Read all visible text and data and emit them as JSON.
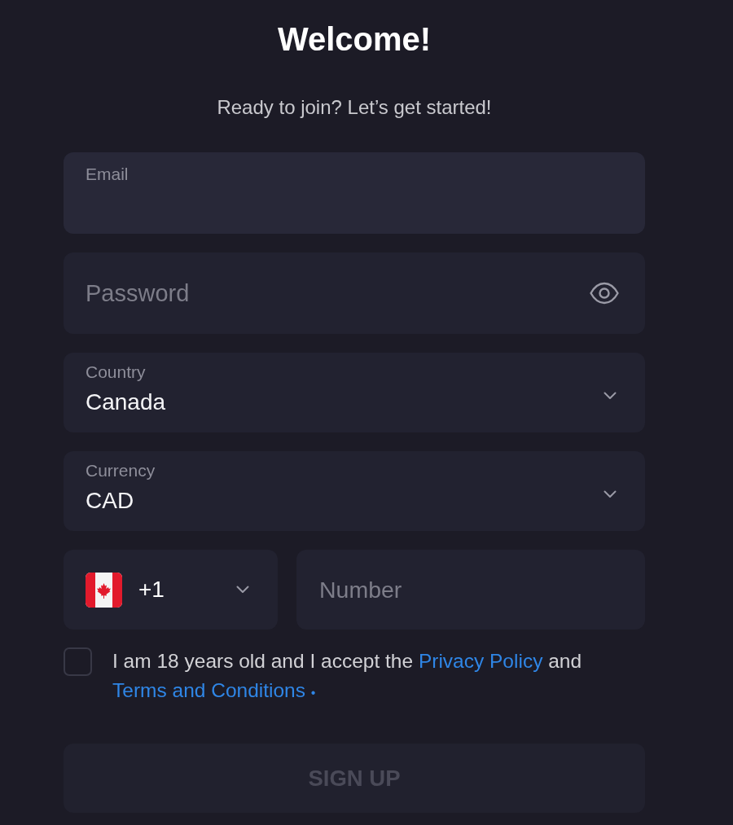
{
  "header": {
    "title": "Welcome!",
    "subtitle": "Ready to join? Let’s get started!"
  },
  "fields": [
    {
      "kind": "email",
      "label": "Email",
      "focused": true
    },
    {
      "kind": "password",
      "placeholder": "Password"
    },
    {
      "kind": "select",
      "label": "Country",
      "value": "Canada"
    },
    {
      "kind": "select",
      "label": "Currency",
      "value": "CAD"
    }
  ],
  "phone": {
    "code": "+1",
    "placeholder": "Number"
  },
  "consent": {
    "checked": false,
    "parts": [
      {
        "kind": "text",
        "text": "I am 18 years old and I accept the"
      },
      {
        "kind": "link",
        "text": "Privacy Policy"
      },
      {
        "kind": "text",
        "text": "and"
      },
      {
        "kind": "link",
        "text": "Terms and Conditions"
      },
      {
        "kind": "required",
        "text": "•"
      }
    ]
  },
  "sign_up_button": {
    "label": "SIGN UP",
    "disabled": true
  }
}
